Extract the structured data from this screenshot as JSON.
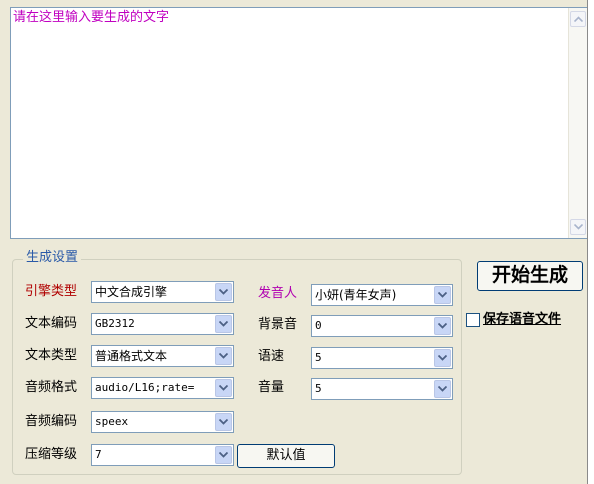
{
  "editor": {
    "text": "请在这里输入要生成的文字"
  },
  "settings": {
    "group_title": "生成设置",
    "engine": {
      "label": "引擎类型",
      "value": "中文合成引擎"
    },
    "text_encoding": {
      "label": "文本编码",
      "value": "GB2312"
    },
    "text_type": {
      "label": "文本类型",
      "value": "普通格式文本"
    },
    "audio_format": {
      "label": "音频格式",
      "value": "audio/L16;rate="
    },
    "audio_codec": {
      "label": "音频编码",
      "value": "speex"
    },
    "compression": {
      "label": "压缩等级",
      "value": "7"
    },
    "speaker": {
      "label": "发音人",
      "value": "小妍(青年女声)"
    },
    "background": {
      "label": "背景音",
      "value": "0"
    },
    "speed": {
      "label": "语速",
      "value": "5"
    },
    "volume": {
      "label": "音量",
      "value": "5"
    },
    "default_button": "默认值"
  },
  "actions": {
    "start_button": "开始生成",
    "save_audio_label": "保存语音文件",
    "save_audio_checked": false
  },
  "icons": {
    "scroll_up": "arrow-up-icon",
    "scroll_down": "arrow-down-icon",
    "dropdown": "chevron-down-icon"
  },
  "colors": {
    "placeholder_text": "#c000c0",
    "engine_label": "#b00000",
    "speaker_label": "#b000b0",
    "group_title": "#2a5aa8"
  }
}
